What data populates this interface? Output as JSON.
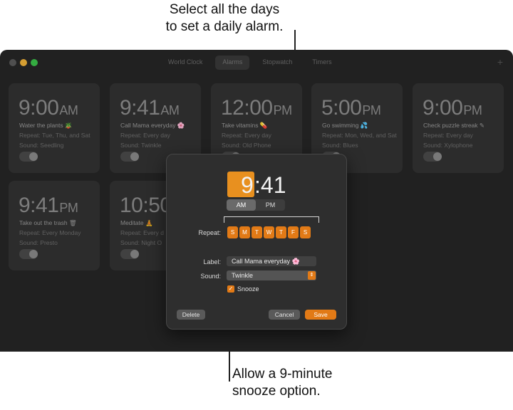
{
  "callouts": {
    "top_line1": "Select all the days",
    "top_line2": "to set a daily alarm.",
    "bottom_line1": "Allow a 9-minute",
    "bottom_line2": "snooze option."
  },
  "window": {
    "tabs": [
      "World Clock",
      "Alarms",
      "Stopwatch",
      "Timers"
    ],
    "active_tab": "Alarms",
    "add_icon": "plus-icon"
  },
  "alarms": [
    {
      "time": "9:00",
      "ampm": "AM",
      "label": "Water the plants 🪴",
      "repeat": "Repeat: Tue, Thu, and Sat",
      "sound": "Sound: Seedling"
    },
    {
      "time": "9:41",
      "ampm": "AM",
      "label": "Call Mama everyday 🌸",
      "repeat": "Repeat: Every day",
      "sound": "Sound: Twinkle"
    },
    {
      "time": "12:00",
      "ampm": "PM",
      "label": "Take vitamins 💊",
      "repeat": "Repeat: Every day",
      "sound": "Sound: Old Phone"
    },
    {
      "time": "5:00",
      "ampm": "PM",
      "label": "Go swimming 💦",
      "repeat": "Repeat: Mon, Wed, and Sat",
      "sound": "Sound: Blues"
    },
    {
      "time": "9:00",
      "ampm": "PM",
      "label": "Check puzzle streak ✎",
      "repeat": "Repeat: Every day",
      "sound": "Sound: Xylophone"
    },
    {
      "time": "9:41",
      "ampm": "PM",
      "label": "Take out the trash 🗑",
      "repeat": "Repeat: Every Monday",
      "sound": "Sound: Presto"
    },
    {
      "time": "10:50",
      "ampm": "",
      "label": "Meditate 🧘",
      "repeat": "Repeat: Every d",
      "sound": "Sound: Night O"
    }
  ],
  "editor": {
    "hour": "9",
    "minutes": ":41",
    "am_label": "AM",
    "pm_label": "PM",
    "selected_period": "AM",
    "repeat_label": "Repeat:",
    "days": [
      "S",
      "M",
      "T",
      "W",
      "T",
      "F",
      "S"
    ],
    "label_label": "Label:",
    "label_value": "Call Mama everyday 🌸",
    "sound_label": "Sound:",
    "sound_value": "Twinkle",
    "snooze_label": "Snooze",
    "snooze_checked": true,
    "delete_label": "Delete",
    "cancel_label": "Cancel",
    "save_label": "Save"
  },
  "colors": {
    "accent": "#e27a16",
    "window_bg": "#262626",
    "card_bg": "#333333"
  }
}
